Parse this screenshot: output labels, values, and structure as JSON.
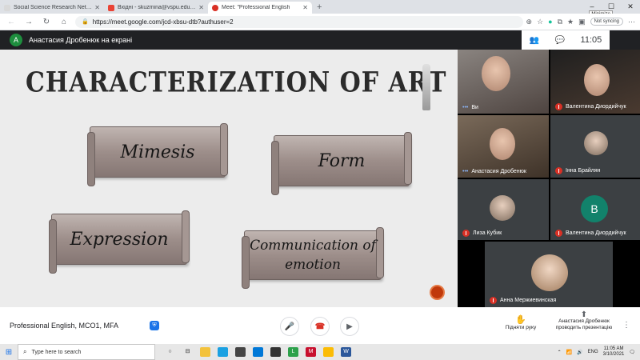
{
  "browser": {
    "tabs": [
      {
        "title": "Social Science Research Network",
        "color": "#ea4335",
        "active": false
      },
      {
        "title": "Вхідні - skuzmina@vspu.edu.ua",
        "color": "#ea4335",
        "active": false
      },
      {
        "title": "Meet: \"Professional English",
        "color": "#d93025",
        "active": true
      }
    ],
    "new_tab": "+",
    "minimize_tooltip": "Minimize",
    "url": "https://meet.google.com/jcd-xbsu-dtb?authuser=2",
    "sync_label": "Not syncing"
  },
  "meet": {
    "presenter_initial": "A",
    "presenter_text": "Анастасия Дробенюк на екрані",
    "clock": "11:05"
  },
  "slide": {
    "title": "CHARACTERIZATION OF ART",
    "scrolls": [
      "Mimesis",
      "Form",
      "Expression",
      "Communication of emotion"
    ]
  },
  "participants": {
    "tiles": [
      {
        "name": "Ви",
        "muted": false
      },
      {
        "name": "Валентина Диордийчук",
        "muted": true
      },
      {
        "name": "Анастасия Дробенюк",
        "muted": false
      },
      {
        "name": "Інна Брайлян",
        "muted": true
      },
      {
        "name": "Лиза Кубик",
        "muted": true
      },
      {
        "name": "Валентина Диордийчук",
        "muted": true
      },
      {
        "name": "Анна Мержиевинская",
        "muted": true
      }
    ],
    "avatar_letter": "B"
  },
  "controls": {
    "meeting_name": "Professional English, MCO1, MFA",
    "raise_hand": "Підняти руку",
    "presenting_line1": "Анастасия Дробенюк",
    "presenting_line2": "проводить презентацію"
  },
  "taskbar": {
    "search_placeholder": "Type here to search",
    "time": "11:05 AM",
    "date": "3/10/2021",
    "lang": "ENG"
  }
}
